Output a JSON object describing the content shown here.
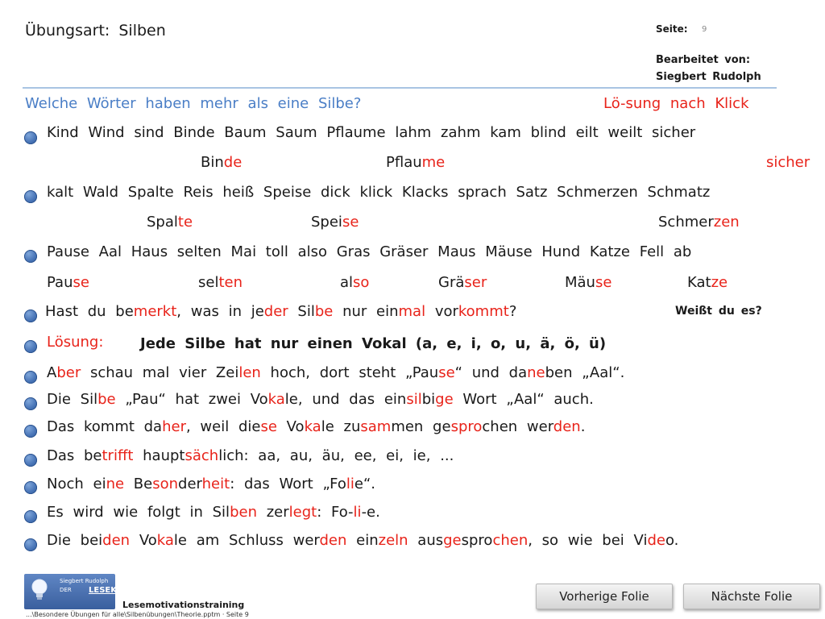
{
  "header": {
    "title": "Übungsart:  Silben",
    "page_label": "Seite:",
    "page_number": "9",
    "edited_by_label": "Bearbeitet  von:",
    "edited_by_name": "Siegbert  Rudolph"
  },
  "question": "Welche  Wörter  haben  mehr  als  eine  Silbe?",
  "solution_hint": "Lö-sung  nach  Klick",
  "rows": [
    {
      "words": "Kind  Wind  sind  Binde  Baum  Saum  Pflaume  lahm  zahm  kam  blind  eilt  weilt  sicher",
      "answers": [
        {
          "base": "Bin",
          "red": "de"
        },
        {
          "base": "Pflau",
          "red": "me"
        },
        {
          "base": "",
          "red": "sicher"
        }
      ]
    },
    {
      "words": "kalt  Wald  Spalte  Reis  heiß  Speise  dick  klick  Klacks  sprach  Satz  Schmerzen  Schmatz",
      "answers": [
        {
          "base": "Spal",
          "red": "te"
        },
        {
          "base": "Spei",
          "red": "se"
        },
        {
          "base": "Schmer",
          "red": "zen"
        }
      ]
    },
    {
      "words": "Pause  Aal  Haus  selten  Mai  toll  also  Gras  Gräser  Maus  Mäuse  Hund  Katze  Fell  ab",
      "answers": [
        {
          "base": "Pau",
          "red": "se"
        },
        {
          "base": "sel",
          "red": "ten"
        },
        {
          "base": "al",
          "red": "so"
        },
        {
          "base": "Grä",
          "red": "ser"
        },
        {
          "base": "Mäu",
          "red": "se"
        },
        {
          "base": "Kat",
          "red": "ze"
        }
      ]
    }
  ],
  "hint_line": {
    "p1": "Hast  du  be",
    "r1": "merkt",
    "p2": ",  was  in  je",
    "r2": "der",
    "p3": "  Sil",
    "r3": "be",
    "p4": "  nur  ein",
    "r4": "mal",
    "p5": "  vor",
    "r5": "kommt",
    "p6": "?"
  },
  "weisst": "Weißt  du  es?",
  "loesung_label": "Lösung:",
  "loesung_text": "Jede  Silbe  hat  nur  einen  Vokal (a, e, i, o, u, ä, ö, ü)",
  "explanation": [
    {
      "p1": "A",
      "r1": "ber",
      "p2": "  schau  mal  vier  Zei",
      "r2": "len",
      "p3": "  hoch,  dort  steht  „Pau",
      "r3": "se",
      "p4": "“  und  da",
      "r4": "ne",
      "p5": "ben  „Aal“."
    },
    {
      "p1": "Die  Sil",
      "r1": "be",
      "p2": "  „Pau“  hat  zwei  Vo",
      "r2": "ka",
      "p3": "le,   und  das  ein",
      "r3": "sil",
      "p4": "bi",
      "r4": "ge",
      "p5": "  Wort  „Aal“  auch."
    },
    {
      "p1": "Das  kommt  da",
      "r1": "her",
      "p2": ",  weil  die",
      "r2": "se",
      "p3": "  Vo",
      "r3": "ka",
      "p4": "le  zu",
      "r4": "sam",
      "p5": "men  ge",
      "r5": "spro",
      "p6": "chen  wer",
      "r6": "den",
      "p7": "."
    },
    {
      "p1": "Das  be",
      "r1": "trifft",
      "p2": "  haupt",
      "r2": "säch",
      "p3": "lich:  aa,  au,  äu,  ee,  ei,  ie,  ..."
    },
    {
      "p1": "Noch  ei",
      "r1": "ne",
      "p2": "  Be",
      "r2": "son",
      "p3": "der",
      "r3": "heit",
      "p4": ":  das  Wort  „Fo",
      "r4": "li",
      "p5": "e“."
    },
    {
      "p1": "Es  wird  wie  folgt  in  Sil",
      "r1": "ben",
      "p2": "  zer",
      "r2": "legt",
      "p3": ":  Fo-",
      "r3": "li",
      "p4": "-e."
    },
    {
      "p1": "Die  bei",
      "r1": "den",
      "p2": "  Vo",
      "r2": "ka",
      "p3": "le  am  Schluss  wer",
      "r3": "den",
      "p4": "  ein",
      "r4": "zeln",
      "p5": "  aus",
      "r5": "ge",
      "p6": "spro",
      "r6": "chen",
      "p7": ",   so  wie  bei  Vi",
      "r7": "de",
      "p8": "o."
    }
  ],
  "footer": {
    "logo_line1": "Siegbert Rudolph",
    "logo_line2": "DER",
    "logo_line3": "LESEKOCH",
    "title": "Lesemotivationstraining",
    "path": "...\\Besondere Übungen für alle\\Silbenübungen\\Theorie.pptm · Seite 9"
  },
  "buttons": {
    "prev": "Vorherige Folie",
    "next": "Nächste Folie"
  },
  "colors": {
    "accent_blue": "#4a7ec6",
    "highlight_red": "#e8231a",
    "rule_line": "#a9c4e3"
  }
}
